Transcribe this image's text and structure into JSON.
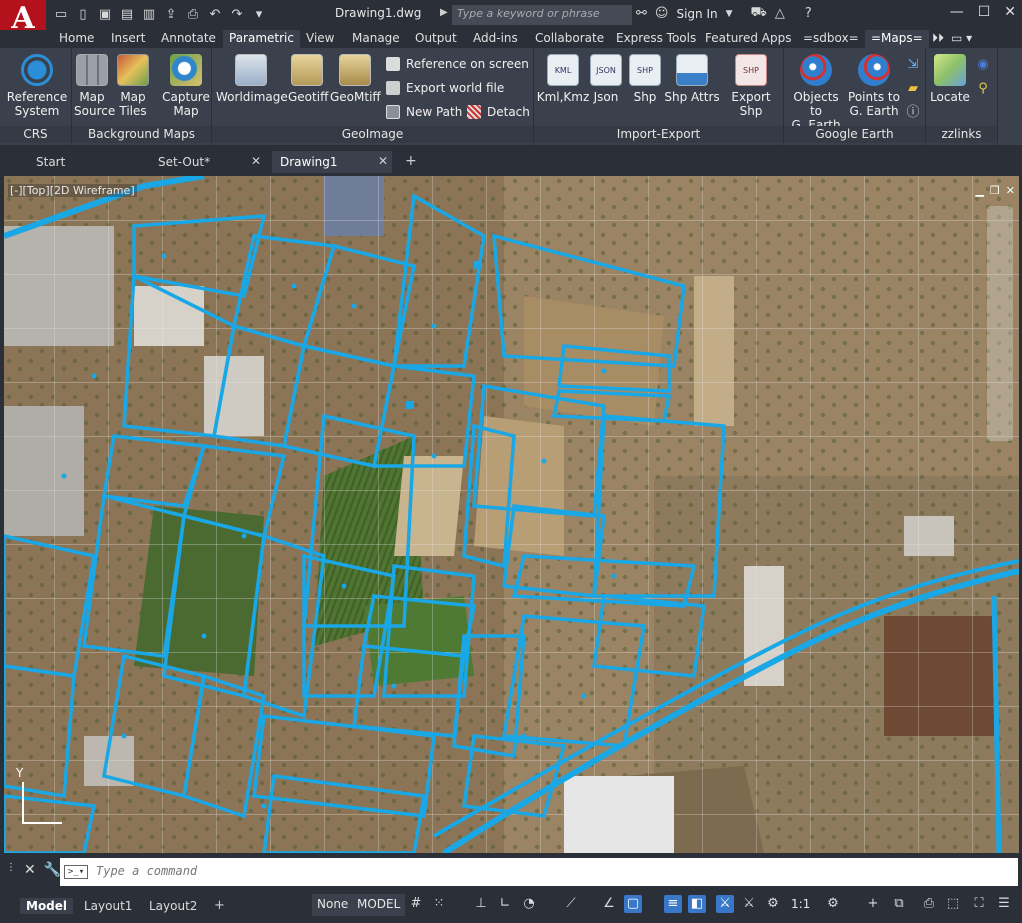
{
  "app": {
    "logo_letter": "A",
    "document_title": "Drawing1.dwg"
  },
  "search": {
    "placeholder": "Type a keyword or phrase"
  },
  "account": {
    "signin_label": "Sign In"
  },
  "menu_tabs": [
    "Home",
    "Insert",
    "Annotate",
    "Parametric",
    "View",
    "Manage",
    "Output",
    "Add-ins",
    "Collaborate",
    "Express Tools",
    "Featured Apps",
    "=sdbox=",
    "=Maps="
  ],
  "active_menu_tab": "Parametric",
  "ribbon": {
    "groups": {
      "crs": "CRS",
      "background_maps": "Background Maps",
      "geoimage": "GeoImage",
      "import_export": "Import-Export",
      "google_earth": "Google Earth",
      "zzlinks": "zzlinks"
    },
    "buttons": {
      "reference_system": "Reference\nSystem",
      "map_source": "Map\nSource",
      "map_tiles": "Map\nTiles",
      "capture_map": "Capture\nMap",
      "worldimage": "Worldimage",
      "geotiff": "Geotiff",
      "geomtiff": "GeoMtiff",
      "reference_on_screen": "Reference on screen",
      "export_world_file": "Export world file",
      "new_path": "New Path",
      "detach": "Detach",
      "kml_kmz": "Kml,Kmz",
      "json": "Json",
      "shp": "Shp",
      "shp_attrs": "Shp Attrs",
      "export_shp": "Export Shp",
      "objects_to_gearth": "Objects to\nG. Earth",
      "points_to_gearth": "Points to\nG. Earth",
      "locate": "Locate"
    },
    "icon_labels": {
      "kml": "KML",
      "json": "JSON",
      "shp": "SHP",
      "export_shp": "SHP"
    }
  },
  "doc_tabs": [
    "Start",
    "Set-Out*",
    "Drawing1"
  ],
  "active_doc_tab": "Drawing1",
  "viewport": {
    "label": "[-][Top][2D Wireframe]",
    "ucs_label": "Y"
  },
  "command": {
    "placeholder": "Type a command"
  },
  "layout_tabs": [
    "Model",
    "Layout1",
    "Layout2"
  ],
  "status": {
    "none_label": "None",
    "model_label": "MODEL",
    "scale_label": "1:1"
  },
  "colors": {
    "accent": "#3978c8",
    "parcel_line": "#1aa7e6",
    "logo": "#b3121c"
  }
}
